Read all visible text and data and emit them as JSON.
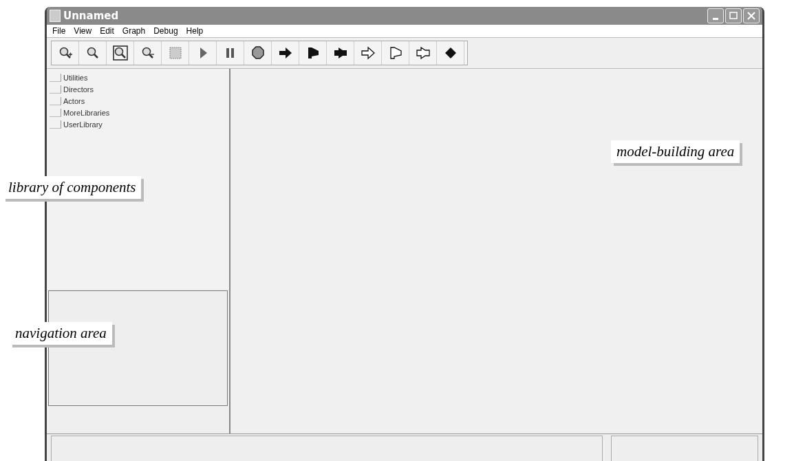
{
  "window": {
    "title": "Unnamed"
  },
  "menu": [
    "File",
    "View",
    "Edit",
    "Graph",
    "Debug",
    "Help"
  ],
  "library": {
    "items": [
      {
        "label": "Utilities"
      },
      {
        "label": "Directors"
      },
      {
        "label": "Actors"
      },
      {
        "label": "MoreLibraries"
      },
      {
        "label": "UserLibrary"
      }
    ]
  },
  "callouts": [
    {
      "text": "library of components",
      "kind": "library"
    },
    {
      "text": "model-building area",
      "kind": "canvas"
    },
    {
      "text": "navigation area",
      "kind": "navigation"
    }
  ]
}
